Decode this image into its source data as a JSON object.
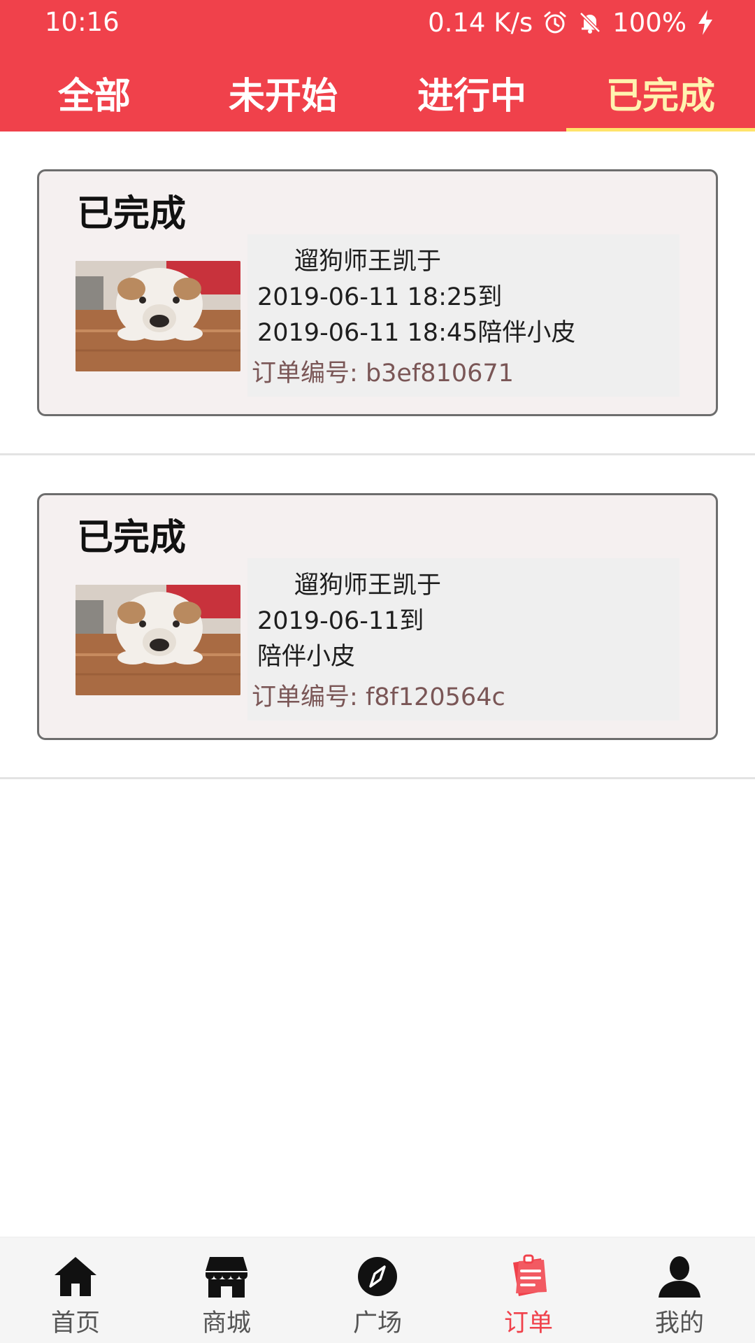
{
  "status_bar": {
    "time": "10:16",
    "network_speed": "0.14 K/s",
    "battery": "100%",
    "icons": [
      "alarm-icon",
      "bell-off-icon",
      "charging-icon"
    ]
  },
  "tabs": [
    {
      "label": "全部",
      "active": false
    },
    {
      "label": "未开始",
      "active": false
    },
    {
      "label": "进行中",
      "active": false
    },
    {
      "label": "已完成",
      "active": true
    }
  ],
  "orders": [
    {
      "status": "已完成",
      "photo": "bulldog-photo",
      "description_lines": [
        "遛狗师王凯于",
        "2019-06-11 18:25到",
        "2019-06-11 18:45陪伴小皮"
      ],
      "order_no_label": "订单编号:",
      "order_no": "b3ef810671"
    },
    {
      "status": "已完成",
      "photo": "bulldog-photo",
      "description_lines": [
        "遛狗师王凯于",
        "2019-06-11到",
        "陪伴小皮"
      ],
      "order_no_label": "订单编号:",
      "order_no": "f8f120564c"
    }
  ],
  "bottom_nav": [
    {
      "label": "首页",
      "icon": "home-icon",
      "active": false
    },
    {
      "label": "商城",
      "icon": "store-icon",
      "active": false
    },
    {
      "label": "广场",
      "icon": "compass-icon",
      "active": false
    },
    {
      "label": "订单",
      "icon": "orders-icon",
      "active": true
    },
    {
      "label": "我的",
      "icon": "user-icon",
      "active": false
    }
  ],
  "colors": {
    "primary": "#f0414b",
    "tab_active_text": "#fff3b0",
    "tab_indicator": "#ffe36a",
    "card_background": "#f5f0f0",
    "order_no_text": "#7a5656"
  }
}
